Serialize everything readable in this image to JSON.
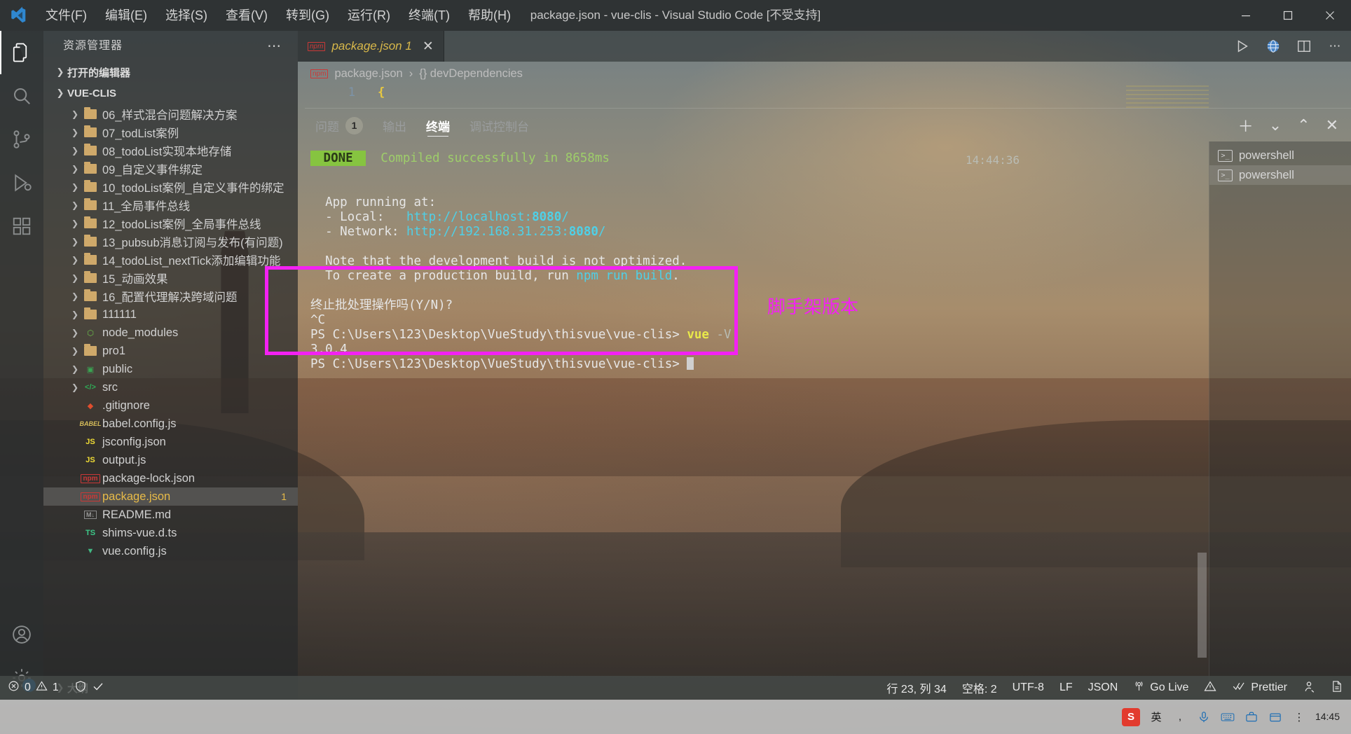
{
  "window": {
    "title": "package.json - vue-clis - Visual Studio Code [不受支持]",
    "logo_icon": "vscode-logo",
    "minimize_label": "─",
    "maximize_label": "☐",
    "close_label": "✕"
  },
  "menu": [
    {
      "label": "文件(F)"
    },
    {
      "label": "编辑(E)"
    },
    {
      "label": "选择(S)"
    },
    {
      "label": "查看(V)"
    },
    {
      "label": "转到(G)"
    },
    {
      "label": "运行(R)"
    },
    {
      "label": "终端(T)"
    },
    {
      "label": "帮助(H)"
    }
  ],
  "activitybar": [
    {
      "name": "explorer",
      "icon": "files-icon",
      "active": true,
      "badge": ""
    },
    {
      "name": "search",
      "icon": "search-icon",
      "active": false,
      "badge": ""
    },
    {
      "name": "source-control",
      "icon": "source-control-icon",
      "active": false,
      "badge": ""
    },
    {
      "name": "run-debug",
      "icon": "run-debug-icon",
      "active": false,
      "badge": ""
    },
    {
      "name": "extensions",
      "icon": "extensions-icon",
      "active": false,
      "badge": ""
    },
    {
      "name": "accounts",
      "icon": "account-icon",
      "active": false,
      "badge": ""
    },
    {
      "name": "settings",
      "icon": "gear-icon",
      "active": false,
      "badge": "1"
    }
  ],
  "sidebar": {
    "title": "资源管理器",
    "actions_icon": "more-actions-icon",
    "open_editors_label": "打开的编辑器",
    "project_label": "VUE-CLIS",
    "outline_label": "大纲",
    "items": [
      {
        "label": "06_样式混合问题解决方案",
        "type": "folder",
        "icon": "folder-icon",
        "expandable": true
      },
      {
        "label": "07_todList案例",
        "type": "folder",
        "icon": "folder-icon",
        "expandable": true
      },
      {
        "label": "08_todoList实现本地存储",
        "type": "folder",
        "icon": "folder-icon",
        "expandable": true
      },
      {
        "label": "09_自定义事件绑定",
        "type": "folder",
        "icon": "folder-icon",
        "expandable": true
      },
      {
        "label": "10_todoList案例_自定义事件的绑定",
        "type": "folder",
        "icon": "folder-icon",
        "expandable": true
      },
      {
        "label": "11_全局事件总线",
        "type": "folder",
        "icon": "folder-icon",
        "expandable": true
      },
      {
        "label": "12_todoList案例_全局事件总线",
        "type": "folder",
        "icon": "folder-icon",
        "expandable": true
      },
      {
        "label": "13_pubsub消息订阅与发布(有问题)",
        "type": "folder",
        "icon": "folder-icon",
        "expandable": true
      },
      {
        "label": "14_todoList_nextTick添加编辑功能",
        "type": "folder",
        "icon": "folder-icon",
        "expandable": true
      },
      {
        "label": "15_动画效果",
        "type": "folder",
        "icon": "folder-icon",
        "expandable": true
      },
      {
        "label": "16_配置代理解决跨域问题",
        "type": "folder",
        "icon": "folder-icon",
        "expandable": true
      },
      {
        "label": "111111",
        "type": "folder",
        "icon": "folder-icon",
        "expandable": true
      },
      {
        "label": "node_modules",
        "type": "node",
        "icon": "nodejs-icon",
        "expandable": true
      },
      {
        "label": "pro1",
        "type": "folder",
        "icon": "folder-icon",
        "expandable": true
      },
      {
        "label": "public",
        "type": "public",
        "icon": "public-folder-icon",
        "expandable": true
      },
      {
        "label": "src",
        "type": "src",
        "icon": "src-folder-icon",
        "expandable": true
      },
      {
        "label": ".gitignore",
        "type": "git",
        "icon": "git-icon",
        "expandable": false
      },
      {
        "label": "babel.config.js",
        "type": "babel",
        "icon": "babel-icon",
        "expandable": false
      },
      {
        "label": "jsconfig.json",
        "type": "jsconfig",
        "icon": "js-config-icon",
        "expandable": false
      },
      {
        "label": "output.js",
        "type": "js",
        "icon": "js-icon",
        "expandable": false
      },
      {
        "label": "package-lock.json",
        "type": "npm",
        "icon": "npm-icon",
        "expandable": false
      },
      {
        "label": "package.json",
        "type": "npm",
        "icon": "npm-icon",
        "expandable": false,
        "selected": true,
        "badge": "1"
      },
      {
        "label": "README.md",
        "type": "md",
        "icon": "markdown-icon",
        "expandable": false
      },
      {
        "label": "shims-vue.d.ts",
        "type": "ts",
        "icon": "typescript-icon",
        "expandable": false
      },
      {
        "label": "vue.config.js",
        "type": "vue",
        "icon": "vue-icon",
        "expandable": false
      }
    ]
  },
  "editor": {
    "tab": {
      "label": "package.json 1",
      "icon": "npm-icon",
      "close_label": "✕"
    },
    "actions": [
      {
        "name": "run-icon",
        "glyph": "▷"
      },
      {
        "name": "browser-preview-icon",
        "glyph": "●"
      },
      {
        "name": "split-editor-icon",
        "glyph": "◫"
      },
      {
        "name": "more-actions-icon",
        "glyph": "⋯"
      }
    ],
    "breadcrumb": [
      {
        "label": "package.json",
        "icon": "npm-icon"
      },
      {
        "label": "{} devDependencies",
        "icon": ""
      }
    ],
    "line_number": "1",
    "line_text": "{"
  },
  "panel": {
    "tabs": [
      {
        "label": "问题",
        "badge": "1",
        "active": false
      },
      {
        "label": "输出",
        "badge": "",
        "active": false
      },
      {
        "label": "终端",
        "badge": "",
        "active": true
      },
      {
        "label": "调试控制台",
        "badge": "",
        "active": false
      }
    ],
    "actions": [
      {
        "name": "new-terminal-icon",
        "glyph": "＋"
      },
      {
        "name": "chevron-down-icon",
        "glyph": "⌄"
      },
      {
        "name": "maximize-panel-icon",
        "glyph": "⌃"
      },
      {
        "name": "close-panel-icon",
        "glyph": "✕"
      }
    ],
    "timestamp": "14:44:36",
    "terminal_list": [
      {
        "label": "powershell",
        "icon": "terminal-icon",
        "active": false
      },
      {
        "label": "powershell",
        "icon": "terminal-icon",
        "active": true
      }
    ],
    "terminal_lines": [
      {
        "segments": [
          {
            "text": " DONE ",
            "style": "done"
          },
          {
            "text": "  Compiled successfully in 8658ms",
            "style": "green"
          }
        ]
      },
      {
        "segments": []
      },
      {
        "segments": []
      },
      {
        "segments": [
          {
            "text": "  App running at:",
            "style": "white"
          }
        ]
      },
      {
        "segments": [
          {
            "text": "  - Local:   ",
            "style": "white"
          },
          {
            "text": "http://localhost:",
            "style": "cyan"
          },
          {
            "text": "8080",
            "style": "cyan-b"
          },
          {
            "text": "/",
            "style": "cyan"
          }
        ]
      },
      {
        "segments": [
          {
            "text": "  - Network: ",
            "style": "white"
          },
          {
            "text": "http://192.168.31.253:",
            "style": "cyan"
          },
          {
            "text": "8080",
            "style": "cyan-b"
          },
          {
            "text": "/",
            "style": "cyan"
          }
        ]
      },
      {
        "segments": []
      },
      {
        "segments": [
          {
            "text": "  Note that the development build is not optimized.",
            "style": "white"
          }
        ]
      },
      {
        "segments": [
          {
            "text": "  To create a production build, run ",
            "style": "white"
          },
          {
            "text": "npm run build",
            "style": "cyan"
          },
          {
            "text": ".",
            "style": "white"
          }
        ]
      },
      {
        "segments": []
      },
      {
        "segments": [
          {
            "text": "终止批处理操作吗(Y/N)?",
            "style": "white"
          }
        ]
      },
      {
        "segments": [
          {
            "text": "^C",
            "style": "white"
          }
        ]
      },
      {
        "segments": [
          {
            "text": "PS C:\\Users\\123\\Desktop\\VueStudy\\thisvue\\vue-clis> ",
            "style": "white"
          },
          {
            "text": "vue",
            "style": "yellow"
          },
          {
            "text": " -V",
            "style": "dim"
          }
        ]
      },
      {
        "segments": [
          {
            "text": "3.0.4",
            "style": "white"
          }
        ]
      },
      {
        "segments": [
          {
            "text": "PS C:\\Users\\123\\Desktop\\VueStudy\\thisvue\\vue-clis> ",
            "style": "white"
          },
          {
            "text": "",
            "style": "cursor"
          }
        ]
      }
    ]
  },
  "annotation": {
    "label": "脚手架版本",
    "color": "#f321f3"
  },
  "statusbar": {
    "left": [
      {
        "name": "errors-warnings",
        "icon": "error-icon",
        "error_count": "0",
        "warning_icon": "warning-icon",
        "warning_count": "1"
      },
      {
        "name": "remote-trust",
        "icon": "shield-check-icon",
        "label": ""
      }
    ],
    "error_count": "0",
    "warning_count": "1",
    "right": [
      {
        "label": "行 23, 列 34",
        "icon": ""
      },
      {
        "label": "空格: 2",
        "icon": ""
      },
      {
        "label": "UTF-8",
        "icon": ""
      },
      {
        "label": "LF",
        "icon": ""
      },
      {
        "label": "JSON",
        "icon": ""
      },
      {
        "label": "Go Live",
        "icon": "broadcast-icon"
      },
      {
        "label": "",
        "icon": "warning-triangle-icon"
      },
      {
        "label": "Prettier",
        "icon": "check-check-icon"
      },
      {
        "label": "",
        "icon": "feedback-icon"
      },
      {
        "label": "",
        "icon": "notebook-icon"
      }
    ]
  },
  "taskbar": {
    "ime_label": "英",
    "tray_icons": [
      {
        "name": "sogou-ime-icon",
        "glyph": "S"
      },
      {
        "name": "ime-lang-icon",
        "glyph": "英"
      },
      {
        "name": "ime-punct-icon",
        "glyph": ","
      },
      {
        "name": "ime-voice-icon",
        "glyph": "🎤"
      },
      {
        "name": "ime-keyboard-icon",
        "glyph": "⌨"
      },
      {
        "name": "ime-toolbox-icon",
        "glyph": "🧰"
      },
      {
        "name": "ime-skin-icon",
        "glyph": "💼"
      },
      {
        "name": "ime-menu-icon",
        "glyph": "⋮"
      }
    ],
    "clock_time": "14:45"
  }
}
